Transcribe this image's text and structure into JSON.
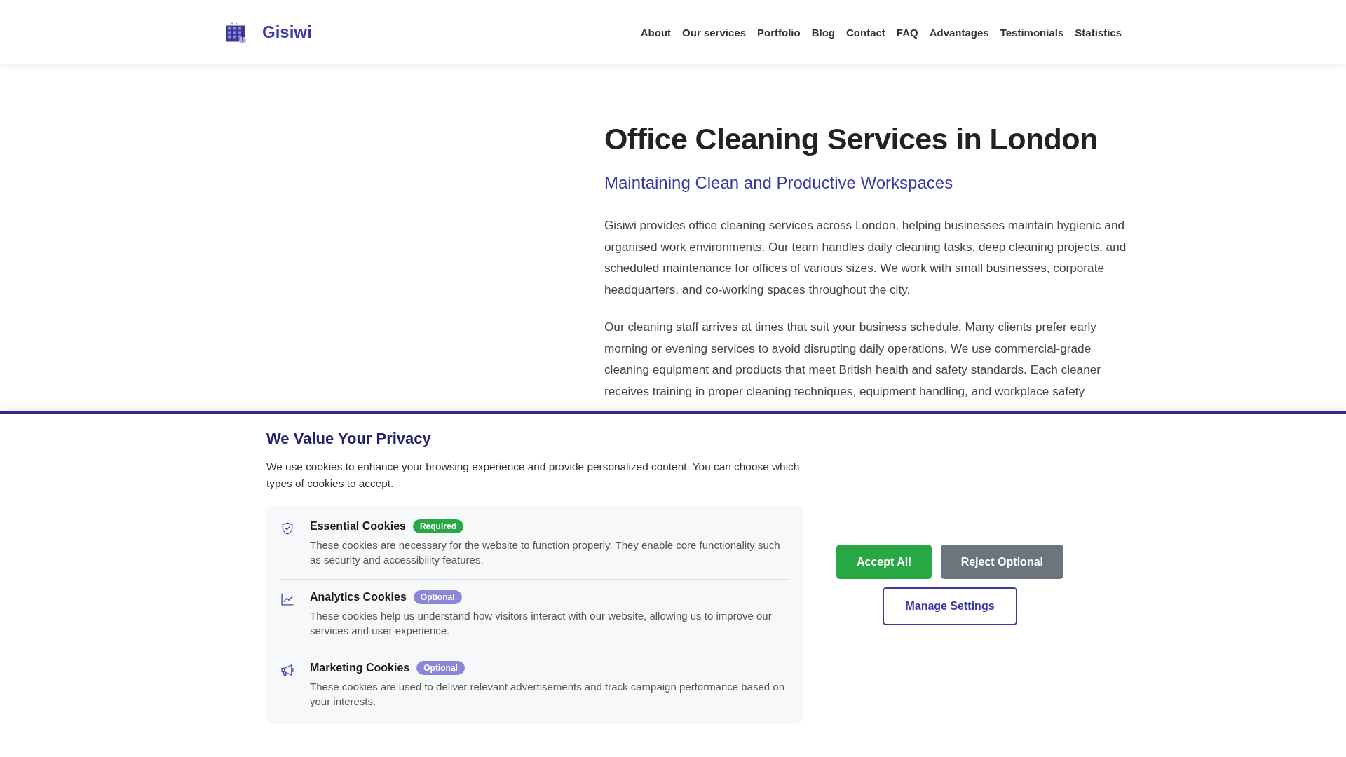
{
  "header": {
    "brand": "Gisiwi",
    "nav": [
      "About",
      "Our services",
      "Portfolio",
      "Blog",
      "Contact",
      "FAQ",
      "Advantages",
      "Testimonials",
      "Statistics"
    ]
  },
  "hero": {
    "title": "Office Cleaning Services in London",
    "subtitle": "Maintaining Clean and Productive Workspaces",
    "paragraphs": [
      "Gisiwi provides office cleaning services across London, helping businesses maintain hygienic and organised work environments. Our team handles daily cleaning tasks, deep cleaning projects, and scheduled maintenance for offices of various sizes. We work with small businesses, corporate headquarters, and co-working spaces throughout the city.",
      "Our cleaning staff arrives at times that suit your business schedule. Many clients prefer early morning or evening services to avoid disrupting daily operations. We use commercial-grade cleaning equipment and products that meet British health and safety standards. Each cleaner receives training in proper cleaning techniques, equipment handling, and workplace safety"
    ]
  },
  "cookie_banner": {
    "title": "We Value Your Privacy",
    "description": "We use cookies to enhance your browsing experience and provide personalized content. You can choose which types of cookies to accept.",
    "categories": [
      {
        "name": "Essential Cookies",
        "badge": "Required",
        "required": true,
        "description": "These cookies are necessary for the website to function properly. They enable core functionality such as security and accessibility features."
      },
      {
        "name": "Analytics Cookies",
        "badge": "Optional",
        "required": false,
        "description": "These cookies help us understand how visitors interact with our website, allowing us to improve our services and user experience."
      },
      {
        "name": "Marketing Cookies",
        "badge": "Optional",
        "required": false,
        "description": "These cookies are used to deliver relevant advertisements and track campaign performance based on your interests."
      }
    ],
    "buttons": [
      {
        "label": "Accept All",
        "kind": "accept"
      },
      {
        "label": "Reject Optional",
        "kind": "reject"
      },
      {
        "label": "Manage Settings",
        "kind": "settings"
      }
    ]
  }
}
